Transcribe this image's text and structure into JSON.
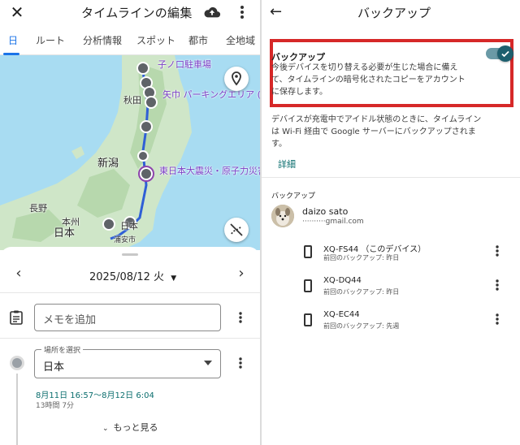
{
  "left": {
    "title": "タイムラインの編集",
    "tabs": [
      "日",
      "ルート",
      "分析情報",
      "スポット",
      "都市",
      "全地域"
    ],
    "map": {
      "labels": {
        "parking1": "子ノ口駐車場",
        "akita": "秋田",
        "parking2": "矢巾 パーキングエリア (下",
        "niigata": "新潟",
        "disaster": "東日本大震災・原子力災害",
        "nagano": "長野",
        "honshu": "本州",
        "japan": "日本",
        "nikko": "日本",
        "urayasu": "浦安市"
      }
    },
    "sheet": {
      "date": "2025/08/12 火",
      "memo_placeholder": "メモを追加",
      "place_legend": "場所を選択",
      "place_value": "日本",
      "time_range": "8月11日 16:57〜8月12日 6:04",
      "duration": "13時間 7分",
      "more_label": "もっと見る"
    }
  },
  "right": {
    "title": "バックアップ",
    "backup_title": "バックアップ",
    "backup_desc": "今後デバイスを切り替える必要が生じた場合に備えて、タイムラインの暗号化されたコピーをアカウントに保存します。",
    "info": "デバイスが充電中でアイドル状態のときに、タイムラインは Wi-Fi 経由で Google サーバーにバックアップされます。",
    "detail_link": "詳細",
    "section_label": "バックアップ",
    "account": {
      "name": "daizo sato",
      "email": "··········gmail.com"
    },
    "devices": [
      {
        "name": "XQ-FS44 （このデバイス）",
        "last": "前回のバックアップ: 昨日"
      },
      {
        "name": "XQ-DQ44",
        "last": "前回のバックアップ: 昨日"
      },
      {
        "name": "XQ-EC44",
        "last": "前回のバックアップ: 先週"
      }
    ],
    "toggle_on": true
  },
  "colors": {
    "accent": "#1a73e8",
    "teal": "#0b6e6e",
    "highlight_red": "#d62828"
  }
}
